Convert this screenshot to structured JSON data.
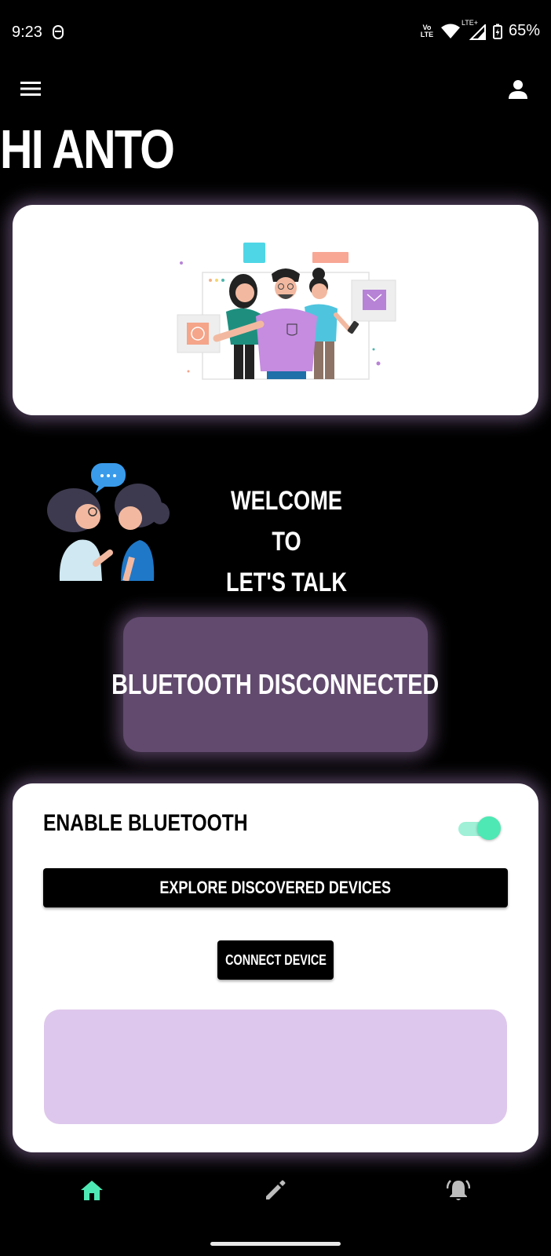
{
  "status_bar": {
    "time": "9:23",
    "volte_label": "Vo LTE",
    "lte_label": "LTE+",
    "battery": "65%"
  },
  "header": {
    "greeting": "HI ANTO"
  },
  "welcome": {
    "line1": "WELCOME TO",
    "line2": "LET'S TALK"
  },
  "bluetooth_status": {
    "text": "BLUETOOTH DISCONNECTED"
  },
  "controls": {
    "enable_label": "ENABLE BLUETOOTH",
    "toggle_on": true,
    "explore_label": "EXPLORE DISCOVERED DEVICES",
    "connect_label": "CONNECT DEVICE"
  },
  "colors": {
    "accent": "#4ee8b4",
    "status_box": "#624a6e",
    "info_box": "#dec7ec"
  },
  "bottom_nav": {
    "items": [
      {
        "icon": "home-icon",
        "active": true
      },
      {
        "icon": "pencil-icon",
        "active": false
      },
      {
        "icon": "bell-alert-icon",
        "active": false
      }
    ]
  }
}
